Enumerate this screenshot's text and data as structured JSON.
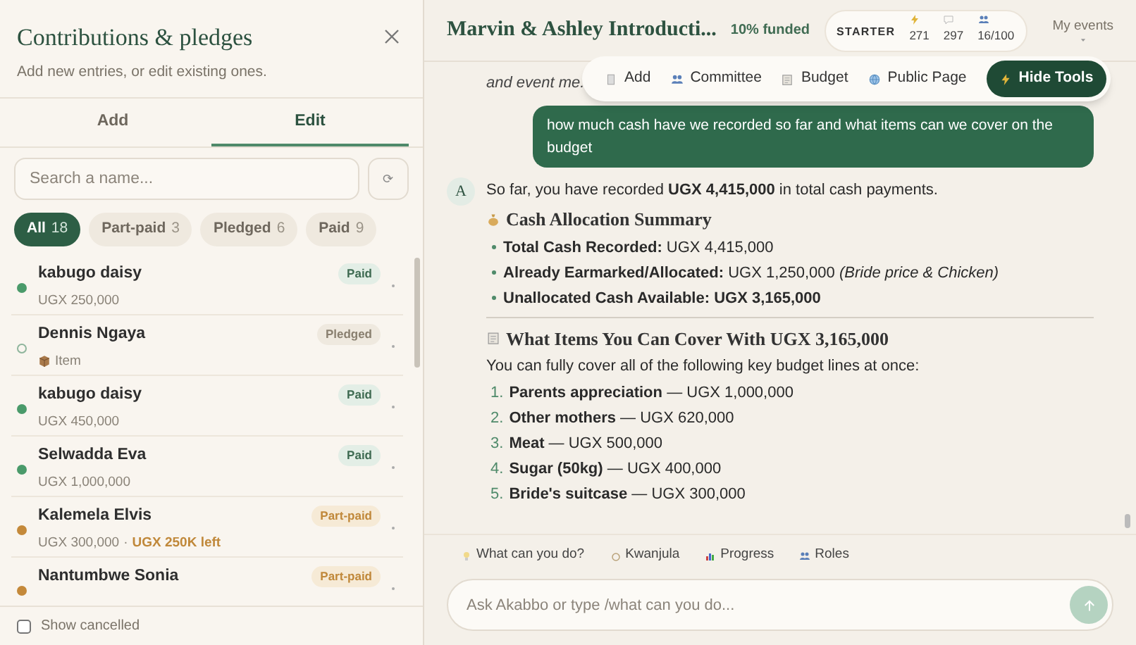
{
  "panel": {
    "title": "Contributions & pledges",
    "subtitle": "Add new entries, or edit existing ones.",
    "tabs": [
      {
        "label": "Add",
        "selected": false
      },
      {
        "label": "Edit",
        "selected": true
      }
    ],
    "search": {
      "placeholder": "Search a name..."
    },
    "refresh_button": "⟳",
    "filters": [
      {
        "label": "All",
        "count": "18",
        "selected": true
      },
      {
        "label": "Part-paid",
        "count": "3",
        "selected": false
      },
      {
        "label": "Pledged",
        "count": "6",
        "selected": false
      },
      {
        "label": "Paid",
        "count": "9",
        "selected": false
      }
    ],
    "entries": [
      {
        "name": "kabugo daisy",
        "detail": "UGX 250,000",
        "status": "Paid",
        "kind": "paid",
        "color": "#4a9a6a"
      },
      {
        "name": "Dennis Ngaya",
        "detail": "Item",
        "item_pledge": true,
        "status": "Pledged",
        "kind": "pledged",
        "color": "#8fb59c"
      },
      {
        "name": "kabugo daisy",
        "detail": "UGX 450,000",
        "status": "Paid",
        "kind": "paid",
        "color": "#4a9a6a"
      },
      {
        "name": "Selwadda Eva",
        "detail": "UGX 1,000,000",
        "status": "Paid",
        "kind": "paid",
        "color": "#4a9a6a"
      },
      {
        "name": "Kalemela Elvis",
        "detail": "UGX 300,000",
        "separator": "·",
        "remaining": "UGX 250K left",
        "status": "Part-paid",
        "kind": "partpaid",
        "color": "#c4893a"
      },
      {
        "name": "Nantumbwe Sonia",
        "status": "Part-paid",
        "kind": "partpaid",
        "color": "#c4893a"
      }
    ],
    "show_cancelled": {
      "label": "Show cancelled",
      "checked": false
    }
  },
  "header": {
    "title": "Marvin & Ashley Introducti...",
    "funded": "10% funded",
    "plan": "STARTER",
    "stats": [
      "271",
      "297",
      "16/100"
    ],
    "menu": "My events"
  },
  "toolbar": [
    {
      "label": "Add",
      "primary": false
    },
    {
      "label": "Committee",
      "primary": false
    },
    {
      "label": "Budget",
      "primary": false
    },
    {
      "label": "Public Page",
      "primary": false
    },
    {
      "label": "Hide Tools",
      "primary": true
    }
  ],
  "chat": {
    "earlier_text": "and event me.",
    "user_message": "how much cash have we recorded so far and what items can we cover on the budget",
    "avatar": "A",
    "blocks": [
      {
        "kind": "paragraph",
        "text": "So far, you have recorded **UGX 4,415,000** in total cash payments."
      },
      {
        "kind": "heading",
        "text": "Cash Allocation Summary"
      },
      {
        "kind": "bullets",
        "items": [
          "**Total Cash Recorded:** UGX 4,415,000",
          "**Already Earmarked/Allocated:** UGX 1,250,000 *(Bride price & Chicken)*",
          "**Unallocated Cash Available: UGX 3,165,000**"
        ]
      },
      {
        "kind": "rule"
      },
      {
        "kind": "heading",
        "text": "What Items You Can Cover With UGX 3,165,000"
      },
      {
        "kind": "paragraph",
        "text": "You can fully cover all of the following key budget lines at once:"
      },
      {
        "kind": "numbered",
        "items": [
          {
            "number": "1.",
            "text": "**Parents appreciation** — UGX 1,000,000"
          },
          {
            "number": "2.",
            "text": "**Other mothers** — UGX 620,000"
          },
          {
            "number": "3.",
            "text": "**Meat** — UGX 500,000"
          },
          {
            "number": "4.",
            "text": "**Sugar (50kg)** — UGX 400,000"
          },
          {
            "number": "5.",
            "text": "**Bride's suitcase** — UGX 300,000"
          }
        ]
      }
    ]
  },
  "suggestions": [
    "What can you do?",
    "Kwanjula",
    "Progress",
    "Roles"
  ],
  "composer": {
    "placeholder": "Ask Akabbo or type /what can you do..."
  }
}
